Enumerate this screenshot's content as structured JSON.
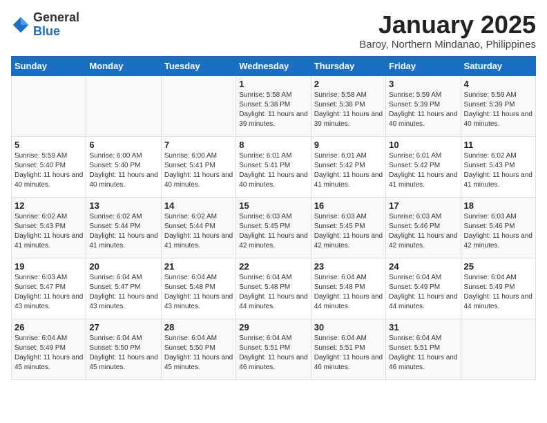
{
  "header": {
    "logo_general": "General",
    "logo_blue": "Blue",
    "month_title": "January 2025",
    "location": "Baroy, Northern Mindanao, Philippines"
  },
  "weekdays": [
    "Sunday",
    "Monday",
    "Tuesday",
    "Wednesday",
    "Thursday",
    "Friday",
    "Saturday"
  ],
  "weeks": [
    [
      {
        "day": "",
        "info": ""
      },
      {
        "day": "",
        "info": ""
      },
      {
        "day": "",
        "info": ""
      },
      {
        "day": "1",
        "info": "Sunrise: 5:58 AM\nSunset: 5:38 PM\nDaylight: 11 hours and 39 minutes."
      },
      {
        "day": "2",
        "info": "Sunrise: 5:58 AM\nSunset: 5:38 PM\nDaylight: 11 hours and 39 minutes."
      },
      {
        "day": "3",
        "info": "Sunrise: 5:59 AM\nSunset: 5:39 PM\nDaylight: 11 hours and 40 minutes."
      },
      {
        "day": "4",
        "info": "Sunrise: 5:59 AM\nSunset: 5:39 PM\nDaylight: 11 hours and 40 minutes."
      }
    ],
    [
      {
        "day": "5",
        "info": "Sunrise: 5:59 AM\nSunset: 5:40 PM\nDaylight: 11 hours and 40 minutes."
      },
      {
        "day": "6",
        "info": "Sunrise: 6:00 AM\nSunset: 5:40 PM\nDaylight: 11 hours and 40 minutes."
      },
      {
        "day": "7",
        "info": "Sunrise: 6:00 AM\nSunset: 5:41 PM\nDaylight: 11 hours and 40 minutes."
      },
      {
        "day": "8",
        "info": "Sunrise: 6:01 AM\nSunset: 5:41 PM\nDaylight: 11 hours and 40 minutes."
      },
      {
        "day": "9",
        "info": "Sunrise: 6:01 AM\nSunset: 5:42 PM\nDaylight: 11 hours and 41 minutes."
      },
      {
        "day": "10",
        "info": "Sunrise: 6:01 AM\nSunset: 5:42 PM\nDaylight: 11 hours and 41 minutes."
      },
      {
        "day": "11",
        "info": "Sunrise: 6:02 AM\nSunset: 5:43 PM\nDaylight: 11 hours and 41 minutes."
      }
    ],
    [
      {
        "day": "12",
        "info": "Sunrise: 6:02 AM\nSunset: 5:43 PM\nDaylight: 11 hours and 41 minutes."
      },
      {
        "day": "13",
        "info": "Sunrise: 6:02 AM\nSunset: 5:44 PM\nDaylight: 11 hours and 41 minutes."
      },
      {
        "day": "14",
        "info": "Sunrise: 6:02 AM\nSunset: 5:44 PM\nDaylight: 11 hours and 41 minutes."
      },
      {
        "day": "15",
        "info": "Sunrise: 6:03 AM\nSunset: 5:45 PM\nDaylight: 11 hours and 42 minutes."
      },
      {
        "day": "16",
        "info": "Sunrise: 6:03 AM\nSunset: 5:45 PM\nDaylight: 11 hours and 42 minutes."
      },
      {
        "day": "17",
        "info": "Sunrise: 6:03 AM\nSunset: 5:46 PM\nDaylight: 11 hours and 42 minutes."
      },
      {
        "day": "18",
        "info": "Sunrise: 6:03 AM\nSunset: 5:46 PM\nDaylight: 11 hours and 42 minutes."
      }
    ],
    [
      {
        "day": "19",
        "info": "Sunrise: 6:03 AM\nSunset: 5:47 PM\nDaylight: 11 hours and 43 minutes."
      },
      {
        "day": "20",
        "info": "Sunrise: 6:04 AM\nSunset: 5:47 PM\nDaylight: 11 hours and 43 minutes."
      },
      {
        "day": "21",
        "info": "Sunrise: 6:04 AM\nSunset: 5:48 PM\nDaylight: 11 hours and 43 minutes."
      },
      {
        "day": "22",
        "info": "Sunrise: 6:04 AM\nSunset: 5:48 PM\nDaylight: 11 hours and 44 minutes."
      },
      {
        "day": "23",
        "info": "Sunrise: 6:04 AM\nSunset: 5:48 PM\nDaylight: 11 hours and 44 minutes."
      },
      {
        "day": "24",
        "info": "Sunrise: 6:04 AM\nSunset: 5:49 PM\nDaylight: 11 hours and 44 minutes."
      },
      {
        "day": "25",
        "info": "Sunrise: 6:04 AM\nSunset: 5:49 PM\nDaylight: 11 hours and 44 minutes."
      }
    ],
    [
      {
        "day": "26",
        "info": "Sunrise: 6:04 AM\nSunset: 5:49 PM\nDaylight: 11 hours and 45 minutes."
      },
      {
        "day": "27",
        "info": "Sunrise: 6:04 AM\nSunset: 5:50 PM\nDaylight: 11 hours and 45 minutes."
      },
      {
        "day": "28",
        "info": "Sunrise: 6:04 AM\nSunset: 5:50 PM\nDaylight: 11 hours and 45 minutes."
      },
      {
        "day": "29",
        "info": "Sunrise: 6:04 AM\nSunset: 5:51 PM\nDaylight: 11 hours and 46 minutes."
      },
      {
        "day": "30",
        "info": "Sunrise: 6:04 AM\nSunset: 5:51 PM\nDaylight: 11 hours and 46 minutes."
      },
      {
        "day": "31",
        "info": "Sunrise: 6:04 AM\nSunset: 5:51 PM\nDaylight: 11 hours and 46 minutes."
      },
      {
        "day": "",
        "info": ""
      }
    ]
  ]
}
